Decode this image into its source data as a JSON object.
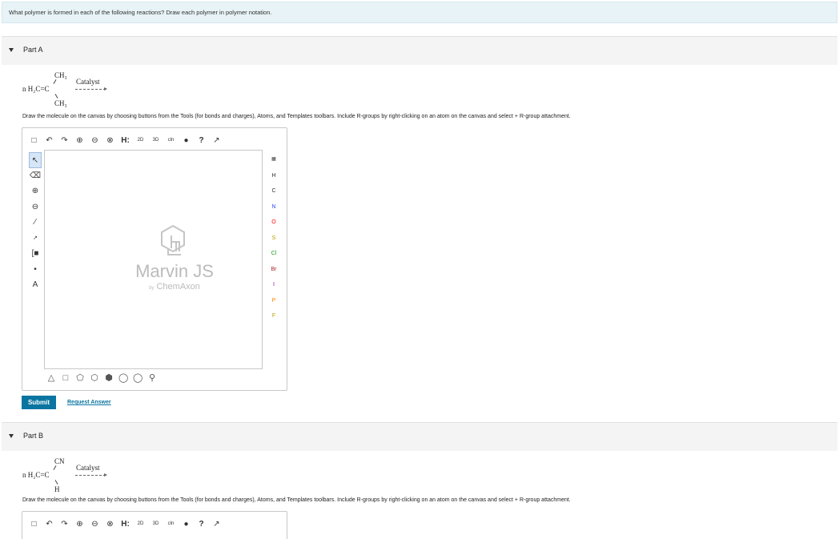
{
  "question": "What polymer is formed in each of the following reactions? Draw each polymer in polymer notation.",
  "partA": {
    "title": "Part A",
    "n_reagent": "n H₂C=C",
    "top_sub": "CH₃",
    "bottom_sub": "CH₃",
    "catalyst": "Catalyst",
    "instruction": "Draw the molecule on the canvas by choosing buttons from the Tools (for bonds and charges), Atoms, and Templates toolbars. Include R-groups by right-clicking on an atom on the canvas and select + R-group attachment."
  },
  "partB": {
    "title": "Part B",
    "n_reagent": "n H₂C=C",
    "top_sub": "CN",
    "bottom_sub": "H",
    "catalyst": "Catalyst",
    "instruction": "Draw the molecule on the canvas by choosing buttons from the Tools (for bonds and charges), Atoms, and Templates toolbars. Include R-groups by right-clicking on an atom on the canvas and select + R-group attachment."
  },
  "editor": {
    "logo_title": "Marvin JS",
    "logo_by": "by",
    "logo_brand": "ChemAxon",
    "top_tools": [
      "new-doc",
      "undo",
      "redo",
      "zoom-in",
      "zoom-out",
      "zoom-fit",
      "H:",
      "2D",
      "3D",
      "clean",
      "info",
      "help",
      "fullscreen"
    ],
    "atoms": [
      "H",
      "C",
      "N",
      "O",
      "S",
      "Cl",
      "Br",
      "I",
      "P",
      "F"
    ],
    "atom_colors": {
      "H": "#333333",
      "C": "#333333",
      "N": "#3050f8",
      "O": "#ff0d0d",
      "S": "#b8a000",
      "Cl": "#1ca01c",
      "Br": "#a62929",
      "I": "#940094",
      "P": "#ff8000",
      "F": "#b8a000"
    }
  },
  "actions": {
    "submit": "Submit",
    "request_answer": "Request Answer"
  }
}
